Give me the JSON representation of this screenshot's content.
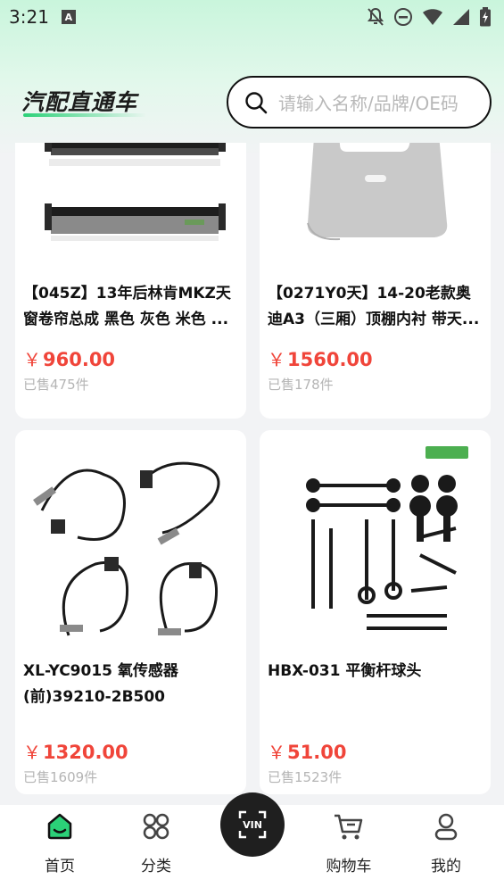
{
  "status_bar": {
    "time": "3:21",
    "app_badge": "A"
  },
  "header": {
    "logo_text": "汽配直通车",
    "search_placeholder": "请输入名称/品牌/OE码"
  },
  "products": [
    {
      "title": "【045Z】13年后林肯MKZ天窗卷帘总成 黑色 灰色 米色 ...",
      "price_symbol": "￥",
      "price": "960.00",
      "sold": "已售475件"
    },
    {
      "title": "【0271Y0天】14-20老款奥迪A3（三厢）顶棚内衬 带天...",
      "price_symbol": "￥",
      "price": "1560.00",
      "sold": "已售178件"
    },
    {
      "title": "XL-YC9015 氧传感器(前)39210-2B500",
      "price_symbol": "￥",
      "price": "1320.00",
      "sold": "已售1609件"
    },
    {
      "title": "HBX-031 平衡杆球头",
      "price_symbol": "￥",
      "price": "51.00",
      "sold": "已售1523件"
    }
  ],
  "tabbar": {
    "home": "首页",
    "category": "分类",
    "vin": "VIN",
    "cart": "购物车",
    "mine": "我的"
  },
  "colors": {
    "accent_green": "#2bd178",
    "price_red": "#f0453a",
    "header_gradient_top": "#c9f5dc"
  }
}
